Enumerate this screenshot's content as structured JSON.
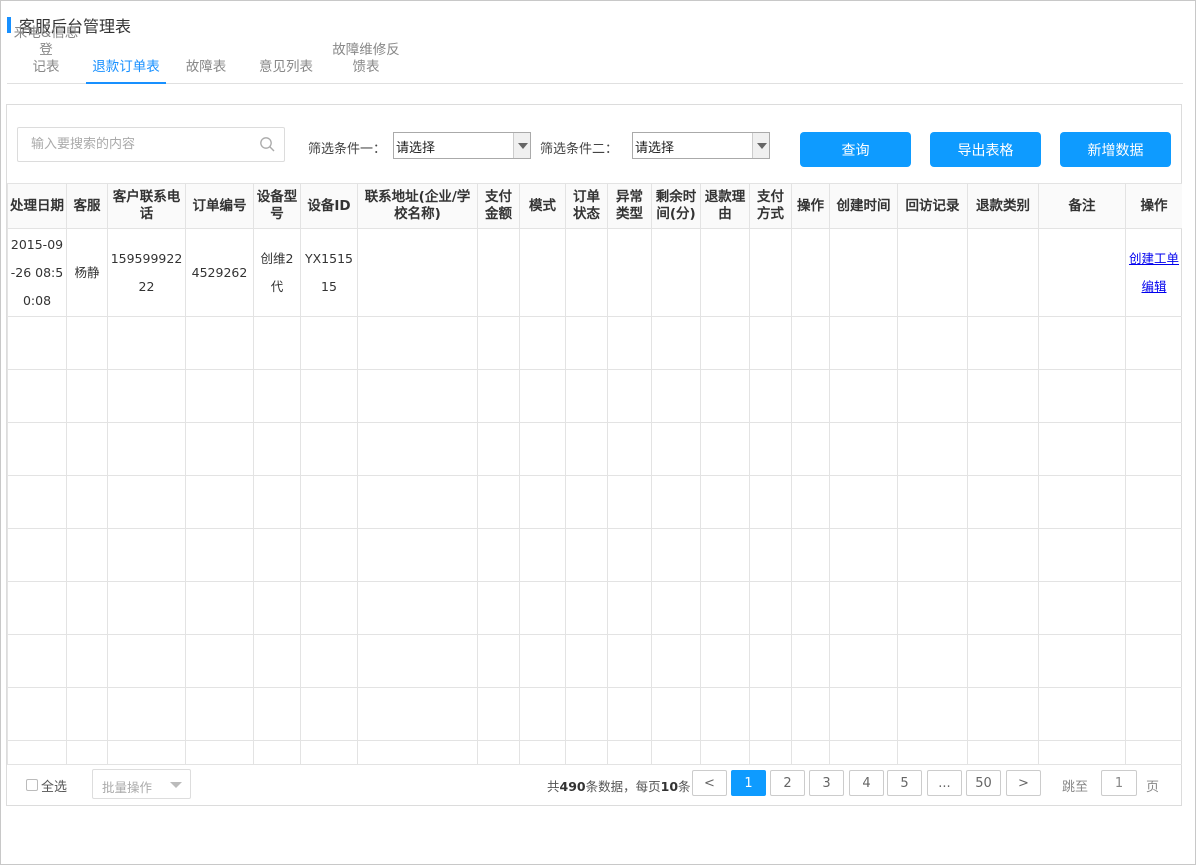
{
  "page_title": "客服后台管理表",
  "tabs": [
    {
      "label": "来电&信息登\n记表",
      "active": false
    },
    {
      "label": "退款订单表",
      "active": true
    },
    {
      "label": "故障表",
      "active": false
    },
    {
      "label": "意见列表",
      "active": false
    },
    {
      "label": "故障维修反\n馈表",
      "active": false
    }
  ],
  "toolbar": {
    "search_placeholder": "输入要搜索的内容",
    "filter1_label": "筛选条件一：",
    "filter1_value": "请选择",
    "filter2_label": "筛选条件二：",
    "filter2_value": "请选择",
    "query_label": "查询",
    "export_label": "导出表格",
    "add_label": "新增数据"
  },
  "table": {
    "headers": [
      "处理日期",
      "客服",
      "客户联系电话",
      "订单编号",
      "设备型号",
      "设备ID",
      "联系地址(企业/学校名称)",
      "支付金额",
      "模式",
      "订单状态",
      "异常类型",
      "剩余时间(分)",
      "退款理由",
      "支付方式",
      "操作",
      "创建时间",
      "回访记录",
      "退款类别",
      "备注",
      "操作"
    ],
    "rows": [
      {
        "date": "2015-09-26 08:50:08",
        "agent": "杨静",
        "phone": "15959992222",
        "order_no": "4529262",
        "model": "创维2代",
        "device_id": "YX151515",
        "address": "",
        "amount": "",
        "mode": "",
        "status": "",
        "anomaly": "",
        "remaining": "",
        "reason": "",
        "pay_method": "",
        "op1": "",
        "created": "",
        "revisit": "",
        "category": "",
        "remark": "",
        "actions": [
          "创建工单",
          "编辑"
        ]
      }
    ]
  },
  "footer": {
    "select_all": "全选",
    "batch_placeholder": "批量操作",
    "total_prefix": "共",
    "total_count": "490",
    "total_mid": "条数据，每页",
    "per_page": "10",
    "total_suffix": "条",
    "prev": "<",
    "pages": [
      "1",
      "2",
      "3",
      "4",
      "5",
      "...",
      "50"
    ],
    "current_page": "1",
    "next": ">",
    "jump_label": "跳至",
    "jump_value": "1",
    "page_unit": "页"
  }
}
